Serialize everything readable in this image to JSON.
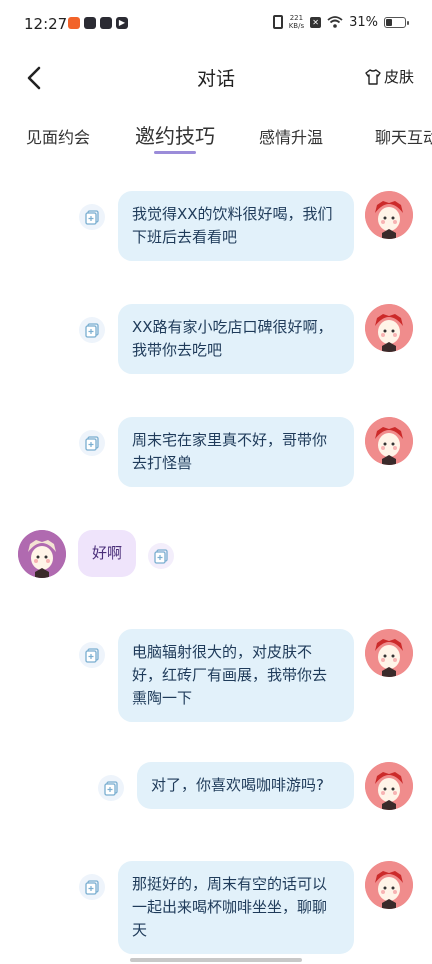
{
  "status": {
    "time": "12:27",
    "net_speed_value": "221",
    "net_speed_unit": "KB/s",
    "battery": "31%"
  },
  "header": {
    "title": "对话",
    "skin_label": "皮肤"
  },
  "tabs": [
    "见面约会",
    "邀约技巧",
    "感情升温",
    "聊天互动"
  ],
  "active_tab": "邀约技巧",
  "colors": {
    "bubble_self": "#e2f1fa",
    "bubble_other": "#efe4fb",
    "tab_underline": "#9b8cd9",
    "avatar_self": "#f08c8c",
    "avatar_other": "#b06ab0"
  },
  "messages": [
    {
      "side": "right",
      "text": "我觉得XX的饮料很好喝，我们下班后去看看吧"
    },
    {
      "side": "right",
      "text": "XX路有家小吃店口碑很好啊，我带你去吃吧"
    },
    {
      "side": "right",
      "text": "周末宅在家里真不好，哥带你去打怪兽"
    },
    {
      "side": "left",
      "text": "好啊"
    },
    {
      "side": "right",
      "text": "电脑辐射很大的，对皮肤不好，红砖厂有画展，我带你去熏陶一下"
    },
    {
      "side": "right",
      "text": "对了，你喜欢喝咖啡游吗?"
    },
    {
      "side": "right",
      "text": "那挺好的，周末有空的话可以一起出来喝杯咖啡坐坐，聊聊天"
    }
  ]
}
